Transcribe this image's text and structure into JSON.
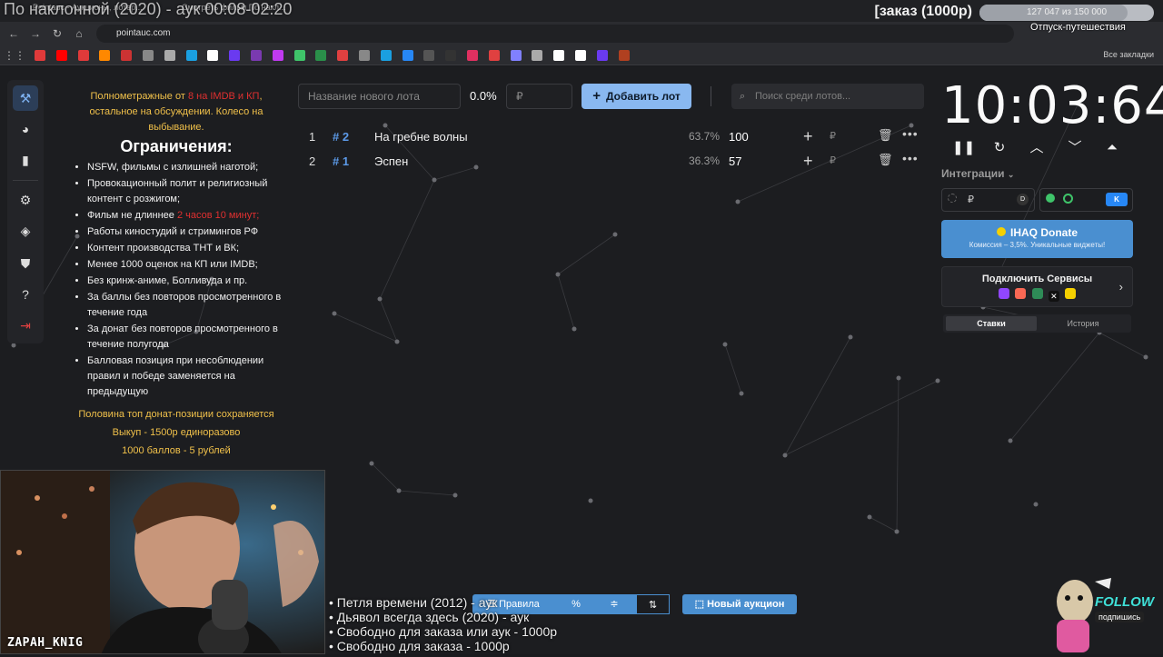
{
  "overlay": {
    "title": "По наклонной (2020) - аук 00:08-02:20",
    "order_banner": "[заказ (1000р)",
    "progress_value": 127047,
    "progress_total": 150000,
    "progress_text": "127 047 из 150 000",
    "goal": "Отпуск-путешествия"
  },
  "browser": {
    "tabs": [
      "Pointauc - Аукционы, лотер...",
      "Смотреть фильм По накл..."
    ],
    "url": "pointauc.com",
    "all_bookmarks": "Все закладки"
  },
  "rules": {
    "intro_pre": "Полнометражные от ",
    "intro_red": "8 на IMDB и КП",
    "intro_post": ", остальное на обсуждении. Колесо на выбывание.",
    "heading": "Ограничения:",
    "items": [
      "NSFW, фильмы с излишней наготой;",
      "Провокационный полит и религиозный контент с розжигом;",
      "Фильм не длиннее ",
      "Работы киностудий и стримингов РФ",
      "Контент производства ТНТ и ВК;",
      "Менее 1000 оценок на КП или IMDB;",
      "Без кринж-аниме, Болливуда и пр.",
      "За баллы без повторов просмотренного в течение года",
      "За донат без повторов просмотренного в течение полугода",
      "Балловая позиция при несоблюдении правил и победе заменяется на предыдущую"
    ],
    "length_red": "2 часов 10 минут;",
    "footer": [
      "Половина топ донат-позиции сохраняется",
      "Выкуп - 1500р единоразово",
      "1000 баллов - 5 рублей"
    ]
  },
  "lot_form": {
    "name_placeholder": "Название нового лота",
    "percent": "0.0%",
    "amount_placeholder": "₽",
    "add_button": "Добавить лот",
    "search_placeholder": "Поиск среди лотов..."
  },
  "lots": [
    {
      "index": "1",
      "id": "# 2",
      "name": "На гребне волны",
      "percent": "63.7%",
      "amount": "100",
      "currency": "₽"
    },
    {
      "index": "2",
      "id": "# 1",
      "name": "Эспен",
      "percent": "36.3%",
      "amount": "57",
      "currency": "₽"
    }
  ],
  "timer": {
    "value": "10:03:64"
  },
  "integrations": {
    "label": "Интеграции",
    "currency": "₽",
    "donate_title": "IHAQ Donate",
    "donate_sub": "Комиссия – 3,5%. Уникальные виджеты!",
    "connect_title": "Подключить Сервисы",
    "tab_bets": "Ставки",
    "tab_history": "История"
  },
  "toolbar": {
    "rules": "Правила",
    "new_auction": "Новый аукцион"
  },
  "webcam": {
    "streamer": "ZAPAH_KNIG"
  },
  "queue": [
    "• Петля времени (2012) - аук",
    "• Дьявол всегда здесь (2020) - аук",
    "• Свободно для заказа или аук - 1000р",
    "• Свободно для заказа - 1000р"
  ],
  "follow": {
    "title": "FOLLOW",
    "sub": "подпишись"
  },
  "colors": {
    "accent": "#4a8fd0",
    "lot_id": "#5c9ae8",
    "gold": "#f0c04a",
    "red": "#e03030",
    "background": "#1c1d20"
  }
}
